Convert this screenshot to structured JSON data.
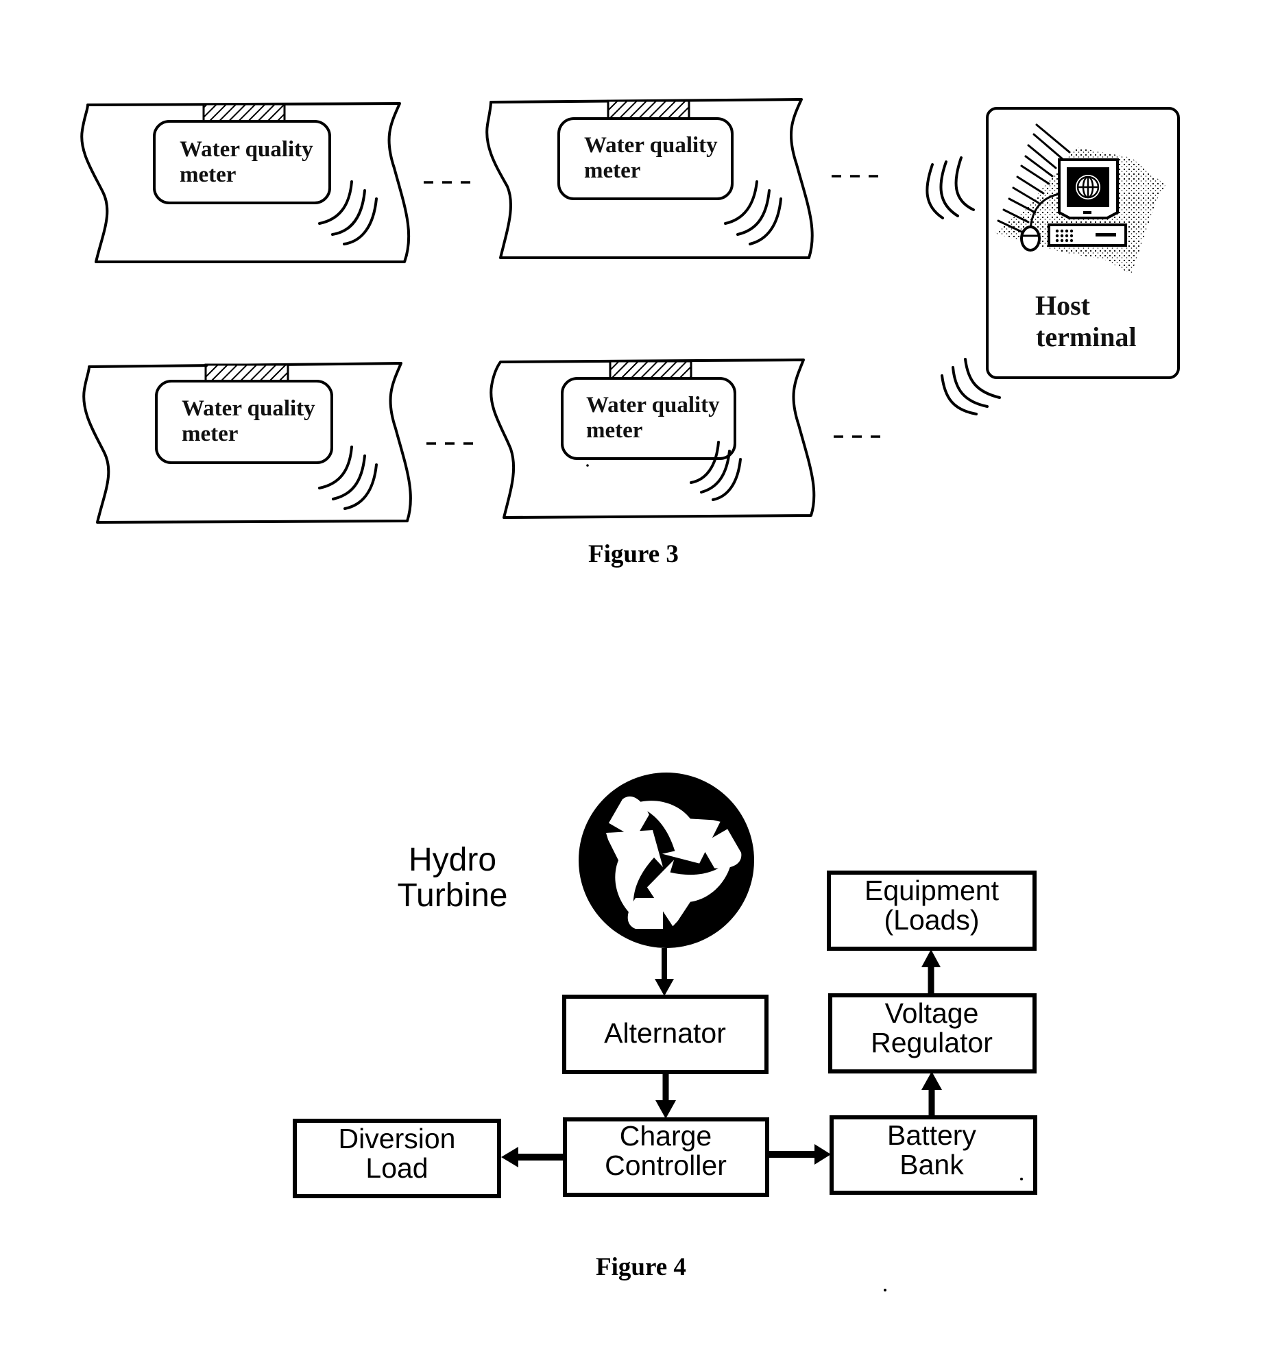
{
  "figure3": {
    "caption": "Figure 3",
    "meters": [
      {
        "line1": "Water quality",
        "line2": "meter"
      },
      {
        "line1": "Water quality",
        "line2": "meter"
      },
      {
        "line1": "Water quality",
        "line2": "meter"
      },
      {
        "line1": "Water quality",
        "line2": "meter"
      }
    ],
    "host": {
      "line1": "Host",
      "line2": "terminal",
      "icon": "computer-globe-icon"
    },
    "continuation": "---"
  },
  "figure4": {
    "caption": "Figure 4",
    "turbine_label": {
      "line1": "Hydro",
      "line2": "Turbine",
      "icon": "recycle-turbine-icon"
    },
    "blocks": {
      "alternator": {
        "line1": "Alternator"
      },
      "charge_controller": {
        "line1": "Charge",
        "line2": "Controller"
      },
      "diversion_load": {
        "line1": "Diversion",
        "line2": "Load"
      },
      "battery_bank": {
        "line1": "Battery",
        "line2": "Bank"
      },
      "voltage_regulator": {
        "line1": "Voltage",
        "line2": "Regulator"
      },
      "equipment": {
        "line1": "Equipment",
        "line2": "(Loads)"
      }
    },
    "flows": [
      {
        "from": "Hydro Turbine",
        "to": "Alternator"
      },
      {
        "from": "Alternator",
        "to": "Charge Controller"
      },
      {
        "from": "Charge Controller",
        "to": "Diversion Load"
      },
      {
        "from": "Charge Controller",
        "to": "Battery Bank"
      },
      {
        "from": "Battery Bank",
        "to": "Voltage Regulator"
      },
      {
        "from": "Voltage Regulator",
        "to": "Equipment (Loads)"
      }
    ]
  }
}
